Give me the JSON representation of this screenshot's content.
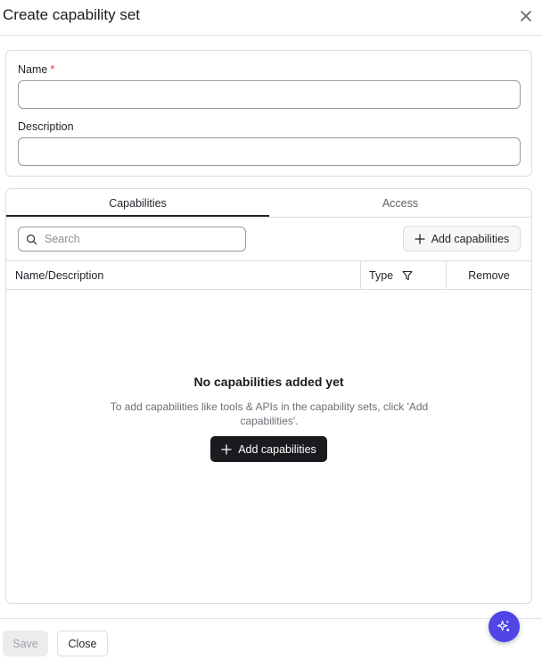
{
  "dialog": {
    "title": "Create capability set",
    "close_icon": "close-icon"
  },
  "form": {
    "name_label": "Name",
    "name_required_marker": "*",
    "name_value": "",
    "description_label": "Description",
    "description_value": ""
  },
  "tabs": [
    {
      "label": "Capabilities",
      "active": true
    },
    {
      "label": "Access",
      "active": false
    }
  ],
  "toolbar": {
    "search_placeholder": "Search",
    "search_icon": "search-icon",
    "add_label": "Add capabilities",
    "add_icon": "plus-icon"
  },
  "table": {
    "columns": [
      "Name/Description",
      "Type",
      "Remove"
    ],
    "filter_icon": "filter-icon",
    "rows": []
  },
  "empty_state": {
    "title": "No capabilities added yet",
    "description": "To add capabilities like tools & APIs in the capability sets, click 'Add capabilities'.",
    "button_label": "Add capabilities"
  },
  "footer": {
    "save_label": "Save",
    "close_label": "Close"
  },
  "assistant_fab_icon": "sparkle-icon",
  "colors": {
    "primary_dark": "#1b1b1f",
    "required": "#d93025",
    "fab": "#4f46e5",
    "border": "#dcdce0"
  }
}
